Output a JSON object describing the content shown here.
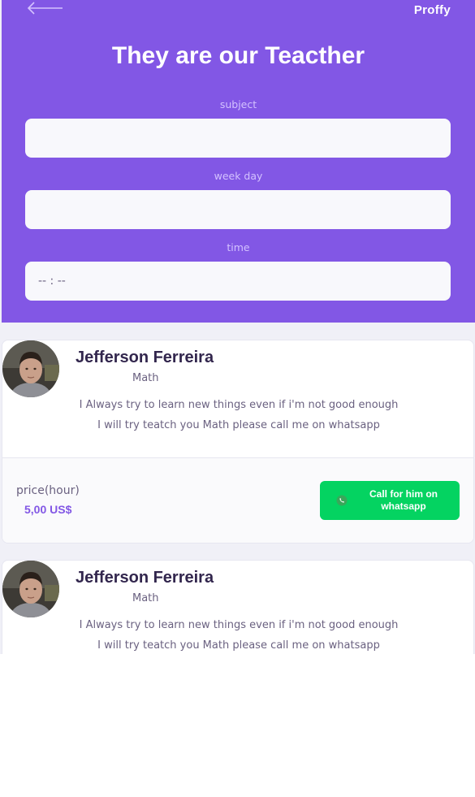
{
  "header": {
    "brand": "Proffy",
    "title": "They are our Teacther",
    "back_icon": "arrow-left-icon",
    "accent_color": "#8257e5"
  },
  "filters": {
    "subject_label": "subject",
    "subject_value": "",
    "weekday_label": "week day",
    "weekday_value": "",
    "time_label": "time",
    "time_value": "-- : --"
  },
  "teachers": [
    {
      "name": "Jefferson Ferreira",
      "subject": "Math",
      "bio_line1": "I Always try to learn new things even if i'm not good enough",
      "bio_line2": "I will try teatch you Math please call me on whatsapp",
      "price_label": "price(hour)",
      "price_value": "5,00 US$",
      "cta_line1": "Call for him on",
      "cta_line2": "whatsapp",
      "cta_icon": "whatsapp-icon",
      "cta_color": "#04d361"
    },
    {
      "name": "Jefferson Ferreira",
      "subject": "Math",
      "bio_line1": "I Always try to learn new things even if i'm not good enough",
      "bio_line2": "I will try teatch you Math please call me on whatsapp"
    }
  ]
}
